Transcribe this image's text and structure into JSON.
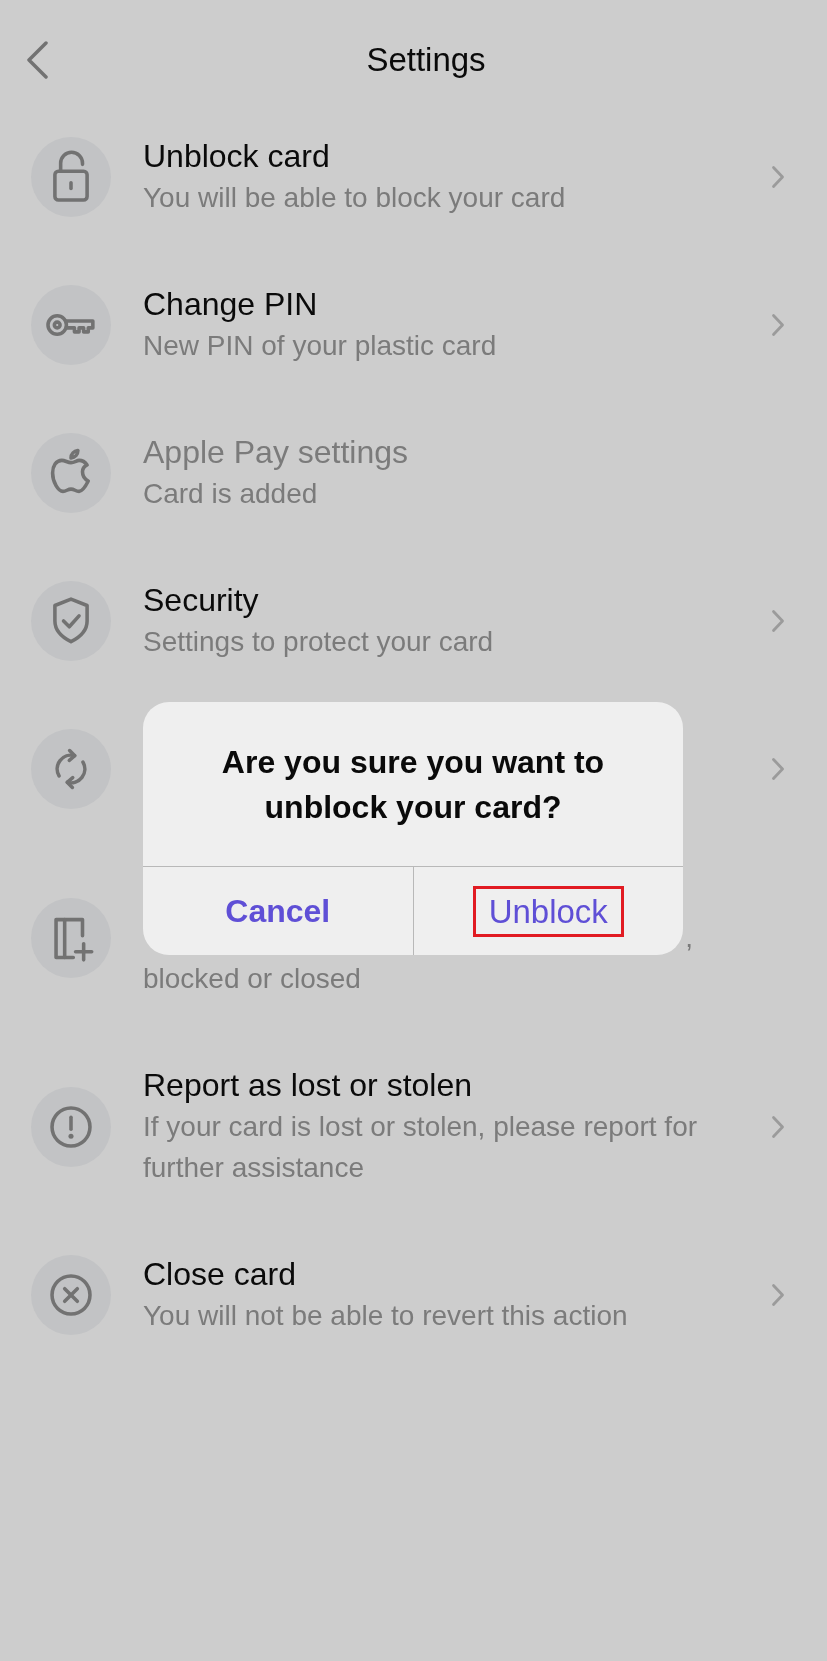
{
  "header": {
    "title": "Settings"
  },
  "items": [
    {
      "title": "Unblock card",
      "subtitle": "You will be able to block your card",
      "disabled": false
    },
    {
      "title": "Change PIN",
      "subtitle": "New PIN of your plastic card",
      "disabled": false
    },
    {
      "title": "Apple Pay settings",
      "subtitle": "Card is added",
      "disabled": true
    },
    {
      "title": "Security",
      "subtitle": "Settings to protect your card",
      "disabled": false
    },
    {
      "disabled": false
    },
    {
      "covered_line_end": ",",
      "subtitle": "blocked or closed",
      "disabled": true
    },
    {
      "title": "Report as lost or stolen",
      "subtitle": "If your card is lost or stolen, please report for further assistance",
      "disabled": false
    },
    {
      "title": "Close card",
      "subtitle": "You will not be able to revert this action",
      "disabled": false
    }
  ],
  "dialog": {
    "title": "Are you sure you want to unblock your card?",
    "buttons": [
      {
        "label": "Cancel",
        "preferred": true,
        "highlighted": false
      },
      {
        "label": "Unblock",
        "preferred": false,
        "highlighted": true
      }
    ]
  }
}
